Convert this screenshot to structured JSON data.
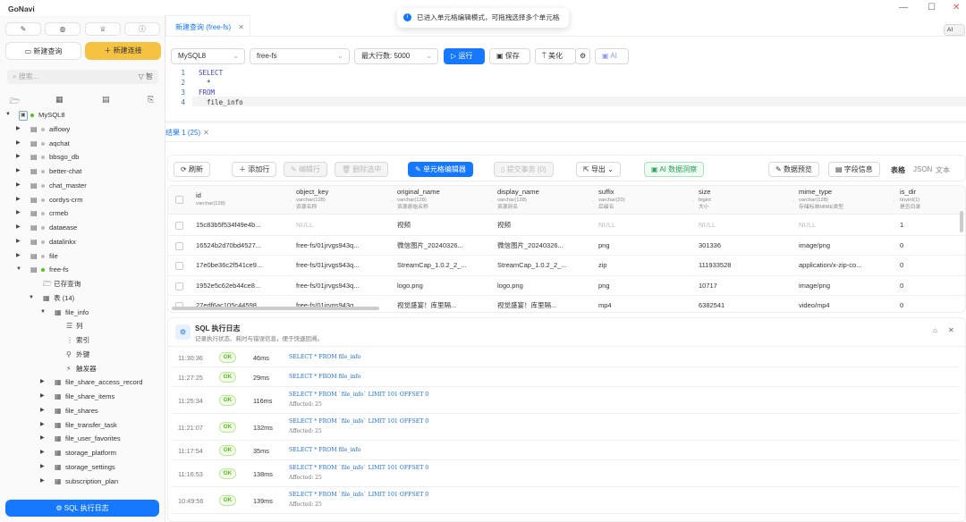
{
  "app": {
    "title": "GoNavi"
  },
  "toast": {
    "text": "已进入单元格编辑模式，可拖拽选择多个单元格"
  },
  "sidebar": {
    "new_query": "新建查询",
    "new_connection": "新建连接",
    "search_placeholder": "搜索...",
    "sql_log_button": "SQL 执行日志",
    "tree": [
      {
        "label": "MySQL8",
        "level": 0,
        "caret": "▼",
        "icon": "connection-icon",
        "dot": "#52c41a"
      },
      {
        "label": "aiflowy",
        "level": 1,
        "caret": "▶",
        "icon": "database-icon",
        "dot": "#bbb"
      },
      {
        "label": "aqchat",
        "level": 1,
        "caret": "▶",
        "icon": "database-icon",
        "dot": "#bbb"
      },
      {
        "label": "bbsgo_db",
        "level": 1,
        "caret": "▶",
        "icon": "database-icon",
        "dot": "#bbb"
      },
      {
        "label": "better-chat",
        "level": 1,
        "caret": "▶",
        "icon": "database-icon",
        "dot": "#bbb"
      },
      {
        "label": "chat_master",
        "level": 1,
        "caret": "▶",
        "icon": "database-icon",
        "dot": "#bbb"
      },
      {
        "label": "cordys-crm",
        "level": 1,
        "caret": "▶",
        "icon": "database-icon",
        "dot": "#bbb"
      },
      {
        "label": "crmeb",
        "level": 1,
        "caret": "▶",
        "icon": "database-icon",
        "dot": "#bbb"
      },
      {
        "label": "dataease",
        "level": 1,
        "caret": "▶",
        "icon": "database-icon",
        "dot": "#bbb"
      },
      {
        "label": "datalinkx",
        "level": 1,
        "caret": "▶",
        "icon": "database-icon",
        "dot": "#bbb"
      },
      {
        "label": "file",
        "level": 1,
        "caret": "▶",
        "icon": "database-icon",
        "dot": "#bbb"
      },
      {
        "label": "free-fs",
        "level": 1,
        "caret": "▼",
        "icon": "database-icon",
        "dot": "#52c41a"
      },
      {
        "label": "已存查询",
        "level": 2,
        "caret": "",
        "icon": "folder-icon"
      },
      {
        "label": "表 (14)",
        "level": 2,
        "caret": "▼",
        "icon": "table-group-icon"
      },
      {
        "label": "file_info",
        "level": 3,
        "caret": "▼",
        "icon": "table-icon"
      },
      {
        "label": "列",
        "level": 4,
        "caret": "",
        "icon": "columns-icon"
      },
      {
        "label": "索引",
        "level": 4,
        "caret": "",
        "icon": "index-icon"
      },
      {
        "label": "外键",
        "level": 4,
        "caret": "",
        "icon": "foreign-key-icon"
      },
      {
        "label": "触发器",
        "level": 4,
        "caret": "",
        "icon": "trigger-icon"
      },
      {
        "label": "file_share_access_record",
        "level": 3,
        "caret": "▶",
        "icon": "table-icon"
      },
      {
        "label": "file_share_items",
        "level": 3,
        "caret": "▶",
        "icon": "table-icon"
      },
      {
        "label": "file_shares",
        "level": 3,
        "caret": "▶",
        "icon": "table-icon"
      },
      {
        "label": "file_transfer_task",
        "level": 3,
        "caret": "▶",
        "icon": "table-icon"
      },
      {
        "label": "file_user_favorites",
        "level": 3,
        "caret": "▶",
        "icon": "table-icon"
      },
      {
        "label": "storage_platform",
        "level": 3,
        "caret": "▶",
        "icon": "table-icon"
      },
      {
        "label": "storage_settings",
        "level": 3,
        "caret": "▶",
        "icon": "table-icon"
      },
      {
        "label": "subscription_plan",
        "level": 3,
        "caret": "▶",
        "icon": "table-icon"
      }
    ]
  },
  "editor": {
    "tab": "新建查询 (free-fs)",
    "connection": "MySQL8",
    "database": "free-fs",
    "max_rows": "最大行数: 5000",
    "run": "运行",
    "save": "保存",
    "beautify": "美化",
    "ai": "AI",
    "ai_side": "AI",
    "lines": [
      {
        "n": "1",
        "t": "SELECT",
        "kw": true
      },
      {
        "n": "2",
        "t": "  *",
        "kw": false
      },
      {
        "n": "3",
        "t": "FROM",
        "kw": true
      },
      {
        "n": "4",
        "t": "  file_info",
        "kw": false
      }
    ]
  },
  "results": {
    "tab": "结果 1 (25)",
    "toolbar": {
      "refresh": "刷新",
      "add_row": "添加行",
      "edit_row": "编辑行",
      "delete_selected": "删除选中",
      "cell_editor": "单元格编辑器",
      "commit": "提交事务 (0)",
      "export": "导出",
      "ai_insight": "AI 数据洞察",
      "data_preview": "数据预览",
      "field_info": "字段信息",
      "view_table": "表格",
      "view_json": "JSON",
      "view_text": "文本"
    },
    "columns": [
      {
        "name": "id",
        "type": "varchar(128)",
        "comment": ""
      },
      {
        "name": "object_key",
        "type": "varchar(128)",
        "comment": "资源名称"
      },
      {
        "name": "original_name",
        "type": "varchar(128)",
        "comment": "资源原始名称"
      },
      {
        "name": "display_name",
        "type": "varchar(128)",
        "comment": "资源别名"
      },
      {
        "name": "suffix",
        "type": "varchar(20)",
        "comment": "后缀名"
      },
      {
        "name": "size",
        "type": "bigint",
        "comment": "大小"
      },
      {
        "name": "mime_type",
        "type": "varchar(128)",
        "comment": "存储标准MIME类型"
      },
      {
        "name": "is_dir",
        "type": "tinyint(1)",
        "comment": "是否目录"
      }
    ],
    "rows": [
      [
        "15c83b5f534f49e4b...",
        "NULL",
        "视频",
        "视频",
        "NULL",
        "NULL",
        "NULL",
        "1"
      ],
      [
        "16524b2d70bd4527...",
        "free-fs/01jrvgs943q...",
        "微信图片_20240326...",
        "微信图片_20240326...",
        "png",
        "301336",
        "image/png",
        "0"
      ],
      [
        "17e0be36c2f541ce9...",
        "free-fs/01jrvgs943q...",
        "StreamCap_1.0.2_2_...",
        "StreamCap_1.0.2_2_...",
        "zip",
        "111933528",
        "application/x-zip-co...",
        "0"
      ],
      [
        "1952e5c62eb44ce8...",
        "free-fs/01jrvgs943q...",
        "logo.png",
        "logo.png",
        "png",
        "10717",
        "image/png",
        "0"
      ],
      [
        "27edf6ac105c44598...",
        "free-fs/01jrvgs943q...",
        "视觉盛宴！库里隔...",
        "视觉盛宴！库里隔...",
        "mp4",
        "6382541",
        "video/mp4",
        "0"
      ]
    ]
  },
  "sql_log": {
    "title": "SQL 执行日志",
    "subtitle": "记录执行状态、耗时与错误信息，便于快速回溯。",
    "entries": [
      {
        "time": "11:30:36",
        "status": "OK",
        "duration": "46ms",
        "sql": "SELECT * FROM file_info",
        "affected": ""
      },
      {
        "time": "11:27:25",
        "status": "OK",
        "duration": "29ms",
        "sql": "SELECT * FROM file_info",
        "affected": ""
      },
      {
        "time": "11:25:34",
        "status": "OK",
        "duration": "116ms",
        "sql": "SELECT * FROM `file_info` LIMIT 101 OFFSET 0",
        "affected": "Affected: 25"
      },
      {
        "time": "11:21:07",
        "status": "OK",
        "duration": "132ms",
        "sql": "SELECT * FROM `file_info` LIMIT 101 OFFSET 0",
        "affected": "Affected: 25"
      },
      {
        "time": "11:17:54",
        "status": "OK",
        "duration": "35ms",
        "sql": "SELECT * FROM file_info",
        "affected": ""
      },
      {
        "time": "11:16:53",
        "status": "OK",
        "duration": "138ms",
        "sql": "SELECT * FROM `file_info` LIMIT 101 OFFSET 0",
        "affected": "Affected: 25"
      },
      {
        "time": "10:49:56",
        "status": "OK",
        "duration": "139ms",
        "sql": "SELECT * FROM `file_info` LIMIT 101 OFFSET 0",
        "affected": "Affected: 25"
      }
    ]
  },
  "colors": {
    "accent": "#1677ff",
    "new_connection": "#f5c242",
    "ok": "#52c41a"
  }
}
